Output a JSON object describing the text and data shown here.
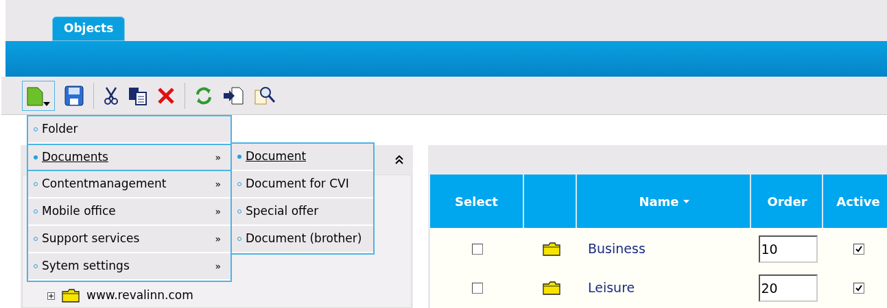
{
  "tabs": [
    {
      "label": "Objects",
      "selected": true
    }
  ],
  "new_menu": {
    "items": [
      {
        "label": "Folder",
        "selected": false
      },
      {
        "label": "Documents",
        "selected": true,
        "submenu_mark": "»"
      },
      {
        "label": "Contentmanagement",
        "selected": false,
        "submenu_mark": "»"
      },
      {
        "label": "Mobile office",
        "selected": false,
        "submenu_mark": "»"
      },
      {
        "label": "Support services",
        "selected": false,
        "submenu_mark": "»"
      },
      {
        "label": "Sytem settings",
        "selected": false,
        "submenu_mark": "»"
      }
    ]
  },
  "submenu": {
    "items": [
      {
        "label": "Document",
        "selected": true
      },
      {
        "label": "Document for CVI",
        "selected": false
      },
      {
        "label": "Special offer",
        "selected": false
      },
      {
        "label": "Document (brother)",
        "selected": false
      }
    ]
  },
  "tree": {
    "items": [
      {
        "label": "www.revalinn.com",
        "expanded": false
      }
    ]
  },
  "table": {
    "columns": [
      {
        "label": "Select"
      },
      {},
      {
        "label": "Name",
        "sorted": true
      },
      {
        "label": "Order"
      },
      {
        "label": "Active"
      }
    ],
    "rows": [
      {
        "selected": false,
        "name": "Business",
        "order": "10",
        "active": true
      },
      {
        "selected": false,
        "name": "Leisure",
        "order": "20",
        "active": true
      }
    ]
  }
}
